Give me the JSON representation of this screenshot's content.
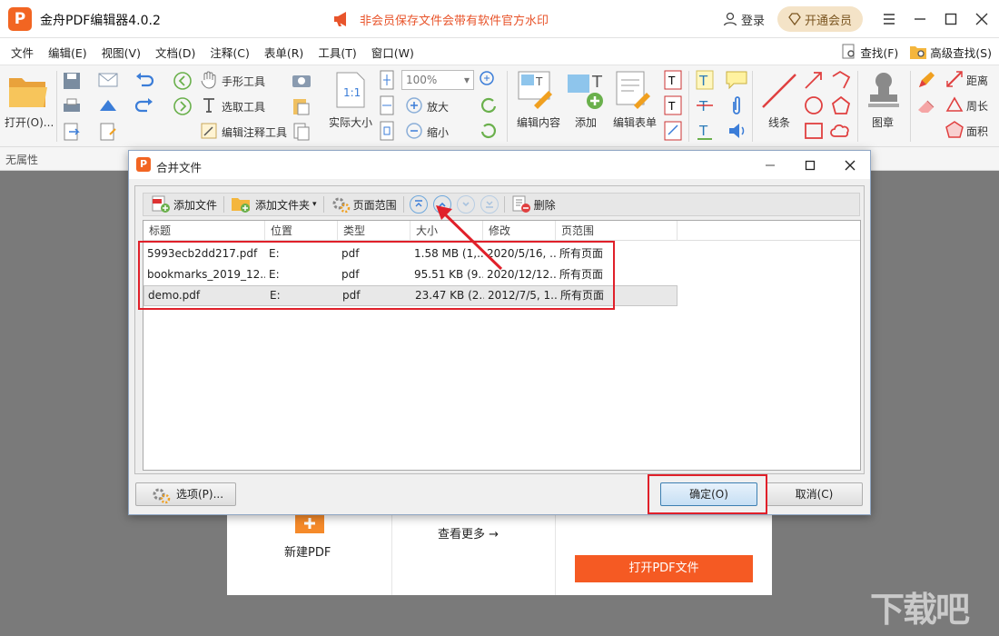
{
  "app": {
    "logo_letter": "P",
    "title": "金舟PDF编辑器4.0.2",
    "notice": "非会员保存文件会带有软件官方水印",
    "login": "登录",
    "vip": "开通会员"
  },
  "menu": [
    "文件",
    "编辑(E)",
    "视图(V)",
    "文档(D)",
    "注释(C)",
    "表单(R)",
    "工具(T)",
    "窗口(W)"
  ],
  "menu_extra": {
    "find": "查找(F)",
    "advanced_find": "高级查找(S)"
  },
  "toolbar": {
    "open": "打开(O)...",
    "hand_tool": "手形工具",
    "select_text": "选取工具",
    "edit_annot": "编辑注释工具",
    "zoom_value": "100%",
    "actual_size": "实际大小",
    "zoom_in": "放大",
    "zoom_out": "缩小",
    "edit_content": "编辑内容",
    "add": "添加",
    "edit_form": "编辑表单",
    "line": "线条",
    "stamp": "图章",
    "distance": "距离",
    "perimeter": "周长",
    "area": "面积"
  },
  "propbar": {
    "label": "无属性"
  },
  "start": {
    "new_pdf": "新建PDF",
    "more": "查看更多 →",
    "open_pdf": "打开PDF文件"
  },
  "dialog": {
    "title": "合并文件",
    "toolbar": {
      "add_file": "添加文件",
      "add_folder": "添加文件夹",
      "page_range": "页面范围",
      "delete": "删除"
    },
    "columns": [
      "标题",
      "位置",
      "类型",
      "大小",
      "修改",
      "页范围"
    ],
    "rows": [
      {
        "title": "5993ecb2dd217.pdf",
        "location": "E:",
        "type": "pdf",
        "size": "1.58 MB (1,..",
        "modified": "2020/5/16, ..",
        "range": "所有页面"
      },
      {
        "title": "bookmarks_2019_12...",
        "location": "E:",
        "type": "pdf",
        "size": "95.51 KB (9..",
        "modified": "2020/12/12...",
        "range": "所有页面"
      },
      {
        "title": "demo.pdf",
        "location": "E:",
        "type": "pdf",
        "size": "23.47 KB (2..",
        "modified": "2012/7/5, 1..",
        "range": "所有页面"
      }
    ],
    "options": "选项(P)...",
    "ok": "确定(O)",
    "cancel": "取消(C)"
  },
  "colors": {
    "brand": "#f26522",
    "highlight": "#e0202a",
    "open_button": "#f55a23"
  }
}
